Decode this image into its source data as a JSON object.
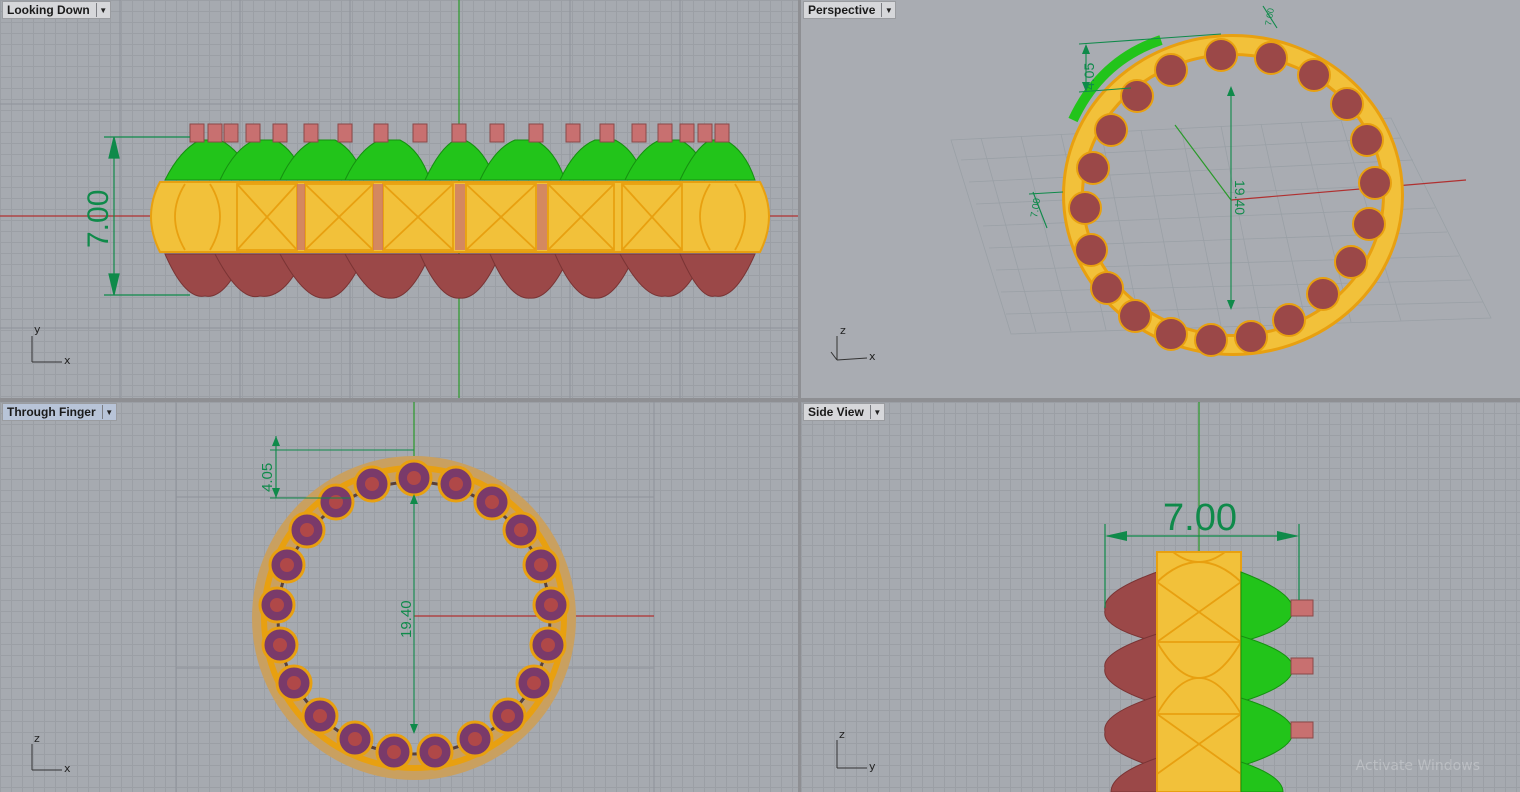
{
  "viewports": {
    "top_left": {
      "title": "Looking Down",
      "axis_a": "y",
      "axis_b": "x",
      "dimension": "7.00"
    },
    "top_right": {
      "title": "Perspective",
      "axis_a": "z",
      "axis_b": "x",
      "dim_height": "4.05",
      "dim_diameter": "19.40",
      "dim_width": "7.00",
      "dim_top": "7.00"
    },
    "bottom_left": {
      "title": "Through Finger",
      "axis_a": "z",
      "axis_b": "x",
      "dim_height": "4.05",
      "dim_diameter": "19.40"
    },
    "bottom_right": {
      "title": "Side View",
      "axis_a": "z",
      "axis_b": "y",
      "dimension": "7.00",
      "watermark": "Activate Windows"
    }
  },
  "colors": {
    "gold": "#f2c13a",
    "gold_edge": "#e8a010",
    "green": "#22c41a",
    "maroon": "#9b4848",
    "pink_pin": "#c87070",
    "dimension": "#0f8a4a",
    "axis_red": "#b03030",
    "axis_green": "#2a9a2a"
  }
}
